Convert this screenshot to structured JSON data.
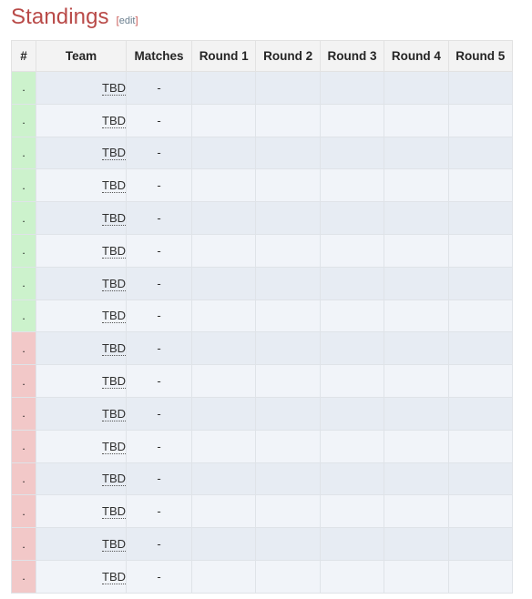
{
  "heading": {
    "title": "Standings",
    "edit_open": "[",
    "edit_label": "edit",
    "edit_close": "]"
  },
  "table": {
    "columns": [
      "#",
      "Team",
      "Matches",
      "Round 1",
      "Round 2",
      "Round 3",
      "Round 4",
      "Round 5"
    ],
    "rank_placeholder": ".",
    "team_placeholder": "TBD",
    "matches_placeholder": "-",
    "round_placeholder": "",
    "qualified_rows": 8,
    "eliminated_rows": 8,
    "colors": {
      "qualified": "#ccf2cc",
      "eliminated": "#f2c8c8",
      "stripe_dark": "#e7ecf3",
      "stripe_light": "#f1f4f9",
      "header_bg": "#f3f3f3",
      "border": "#dfe3e8",
      "title": "#b94a48",
      "edit_bracket": "#c9534f",
      "edit_text": "#6b7f8f"
    },
    "rows": [
      {
        "rank": ".",
        "team": "TBD",
        "matches": "-",
        "status": "qual",
        "rounds": [
          "",
          "",
          "",
          "",
          ""
        ]
      },
      {
        "rank": ".",
        "team": "TBD",
        "matches": "-",
        "status": "qual",
        "rounds": [
          "",
          "",
          "",
          "",
          ""
        ]
      },
      {
        "rank": ".",
        "team": "TBD",
        "matches": "-",
        "status": "qual",
        "rounds": [
          "",
          "",
          "",
          "",
          ""
        ]
      },
      {
        "rank": ".",
        "team": "TBD",
        "matches": "-",
        "status": "qual",
        "rounds": [
          "",
          "",
          "",
          "",
          ""
        ]
      },
      {
        "rank": ".",
        "team": "TBD",
        "matches": "-",
        "status": "qual",
        "rounds": [
          "",
          "",
          "",
          "",
          ""
        ]
      },
      {
        "rank": ".",
        "team": "TBD",
        "matches": "-",
        "status": "qual",
        "rounds": [
          "",
          "",
          "",
          "",
          ""
        ]
      },
      {
        "rank": ".",
        "team": "TBD",
        "matches": "-",
        "status": "qual",
        "rounds": [
          "",
          "",
          "",
          "",
          ""
        ]
      },
      {
        "rank": ".",
        "team": "TBD",
        "matches": "-",
        "status": "qual",
        "rounds": [
          "",
          "",
          "",
          "",
          ""
        ]
      },
      {
        "rank": ".",
        "team": "TBD",
        "matches": "-",
        "status": "elim",
        "rounds": [
          "",
          "",
          "",
          "",
          ""
        ]
      },
      {
        "rank": ".",
        "team": "TBD",
        "matches": "-",
        "status": "elim",
        "rounds": [
          "",
          "",
          "",
          "",
          ""
        ]
      },
      {
        "rank": ".",
        "team": "TBD",
        "matches": "-",
        "status": "elim",
        "rounds": [
          "",
          "",
          "",
          "",
          ""
        ]
      },
      {
        "rank": ".",
        "team": "TBD",
        "matches": "-",
        "status": "elim",
        "rounds": [
          "",
          "",
          "",
          "",
          ""
        ]
      },
      {
        "rank": ".",
        "team": "TBD",
        "matches": "-",
        "status": "elim",
        "rounds": [
          "",
          "",
          "",
          "",
          ""
        ]
      },
      {
        "rank": ".",
        "team": "TBD",
        "matches": "-",
        "status": "elim",
        "rounds": [
          "",
          "",
          "",
          "",
          ""
        ]
      },
      {
        "rank": ".",
        "team": "TBD",
        "matches": "-",
        "status": "elim",
        "rounds": [
          "",
          "",
          "",
          "",
          ""
        ]
      },
      {
        "rank": ".",
        "team": "TBD",
        "matches": "-",
        "status": "elim",
        "rounds": [
          "",
          "",
          "",
          "",
          ""
        ]
      }
    ]
  }
}
